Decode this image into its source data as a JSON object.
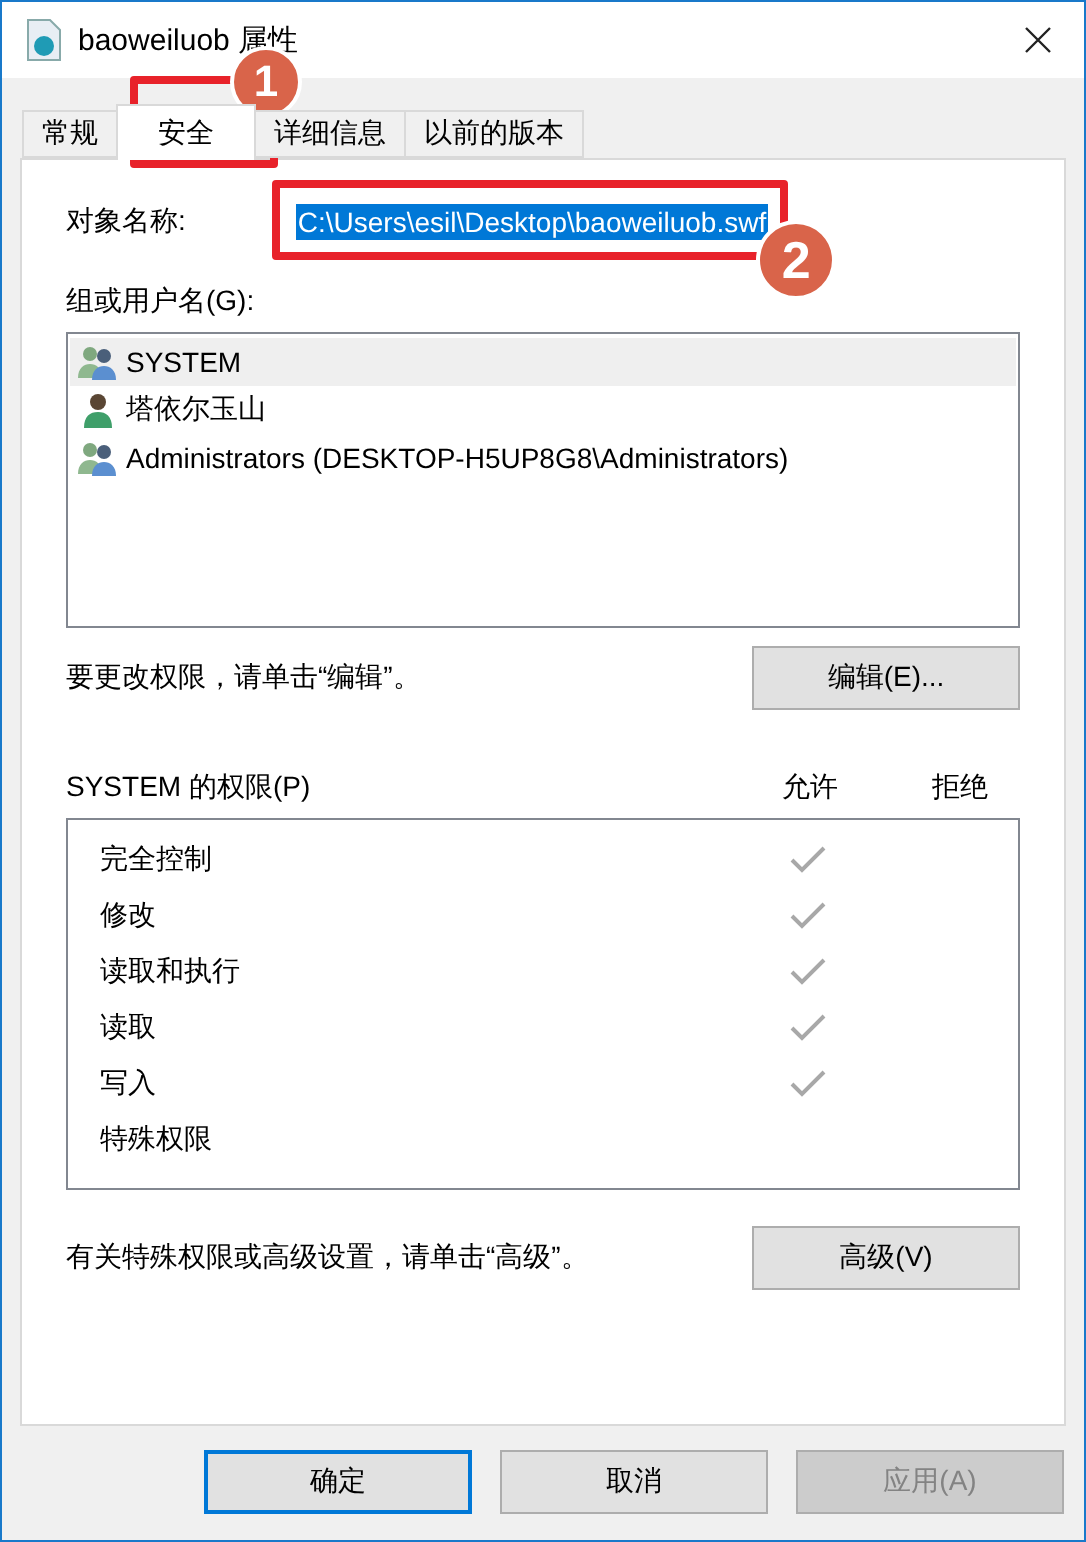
{
  "window": {
    "title": "baoweiluob 属性"
  },
  "tabs": [
    {
      "label": "常规",
      "selected": false
    },
    {
      "label": "安全",
      "selected": true
    },
    {
      "label": "详细信息",
      "selected": false
    },
    {
      "label": "以前的版本",
      "selected": false
    }
  ],
  "object_name": {
    "label": "对象名称:",
    "value": "C:\\Users\\esil\\Desktop\\baoweiluob.swf"
  },
  "groups": {
    "label": "组或用户名(G):",
    "items": [
      {
        "kind": "group",
        "name": "SYSTEM",
        "selected": true
      },
      {
        "kind": "user",
        "name": "塔依尔玉山",
        "selected": false
      },
      {
        "kind": "group",
        "name": "Administrators (DESKTOP-H5UP8G8\\Administrators)",
        "selected": false
      }
    ]
  },
  "edit_hint": "要更改权限，请单击“编辑”。",
  "edit_button": "编辑(E)...",
  "permissions": {
    "label": "SYSTEM 的权限(P)",
    "allow_header": "允许",
    "deny_header": "拒绝",
    "rows": [
      {
        "name": "完全控制",
        "allow": true
      },
      {
        "name": "修改",
        "allow": true
      },
      {
        "name": "读取和执行",
        "allow": true
      },
      {
        "name": "读取",
        "allow": true
      },
      {
        "name": "写入",
        "allow": true
      },
      {
        "name": "特殊权限",
        "allow": false
      }
    ]
  },
  "advanced_hint": "有关特殊权限或高级设置，请单击“高级”。",
  "advanced_button": "高级(V)",
  "buttons": [
    {
      "label": "确定",
      "default": true,
      "disabled": false
    },
    {
      "label": "取消",
      "default": false,
      "disabled": false
    },
    {
      "label": "应用(A)",
      "default": false,
      "disabled": true
    }
  ],
  "annotations": [
    {
      "number": "1"
    },
    {
      "number": "2"
    }
  ]
}
